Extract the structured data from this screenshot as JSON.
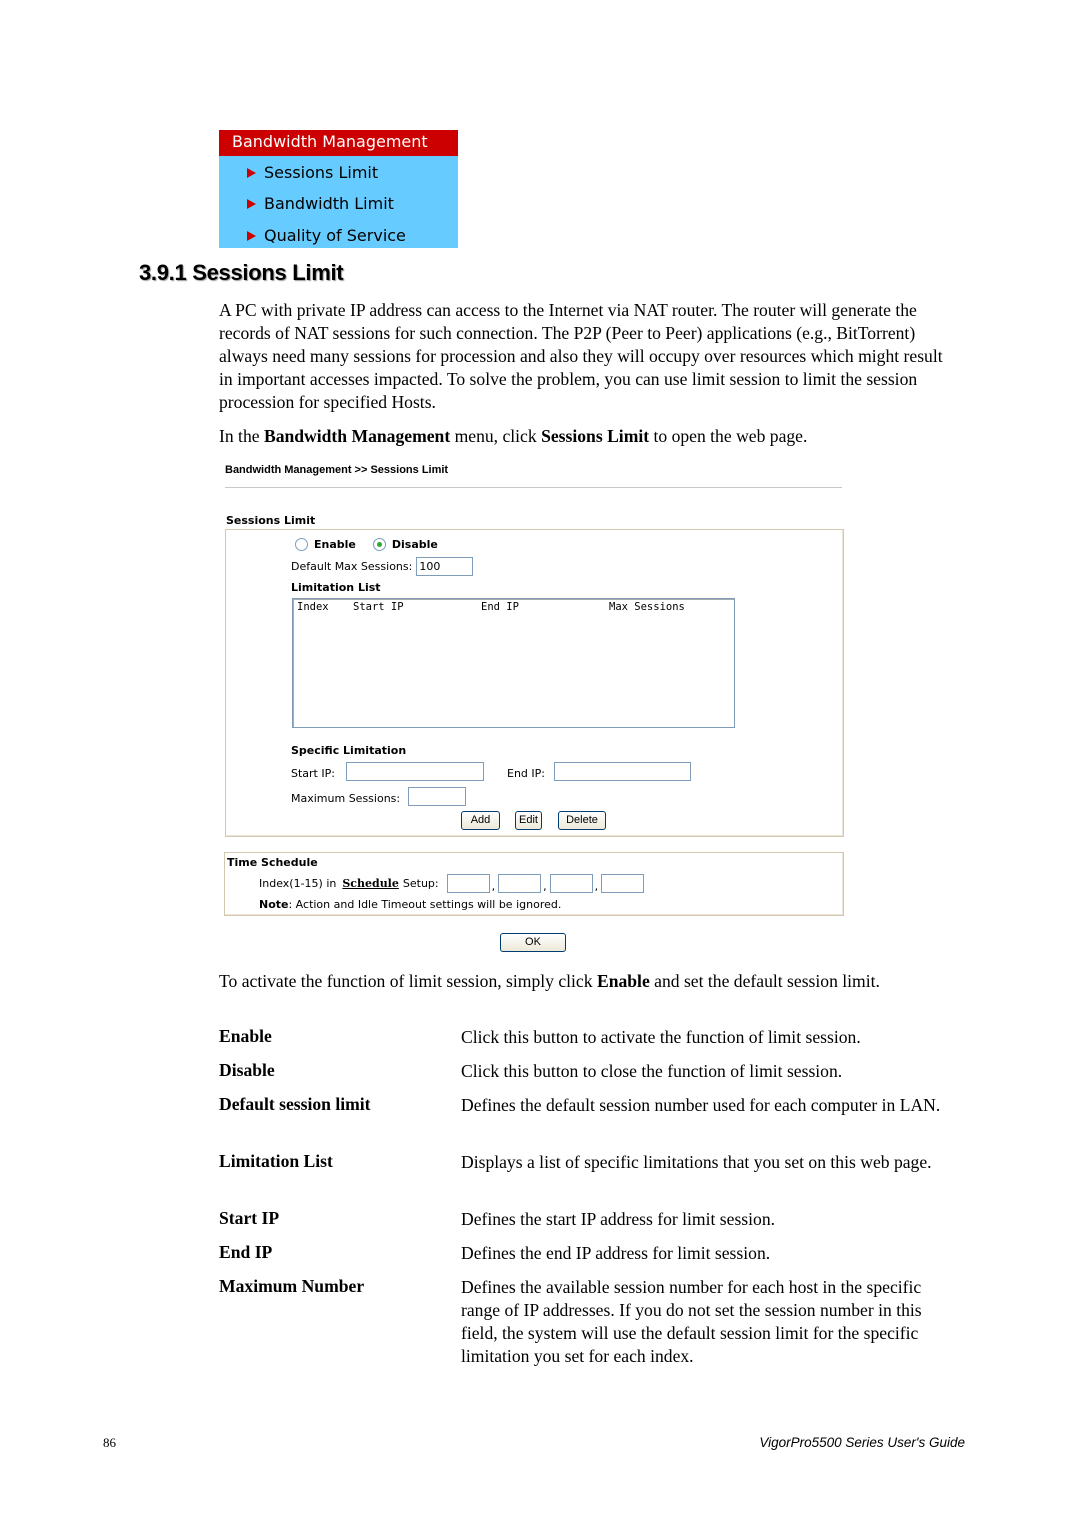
{
  "menu": {
    "title": "Bandwidth Management",
    "items": [
      {
        "label": "Sessions Limit"
      },
      {
        "label": "Bandwidth Limit"
      },
      {
        "label": "Quality of Service"
      }
    ],
    "colors": {
      "title_bg": "#cc0000",
      "body_bg": "#66ccff",
      "arrow": "#cc0000"
    }
  },
  "section": {
    "heading": "3.9.1 Sessions Limit",
    "intro": "A PC with private IP address can access to the Internet via NAT router. The router will generate the records of NAT sessions for such connection. The P2P (Peer to Peer) applications (e.g., BitTorrent) always need many sessions for procession and also they will occupy over resources which might result in important accesses impacted. To solve the problem, you can use limit session to limit the session procession for specified Hosts.",
    "instruction": {
      "prefix": "In the ",
      "menu_name": "Bandwidth Management",
      "middle": " menu, click ",
      "item_name": "Sessions Limit",
      "suffix": " to open the web page."
    },
    "activate": {
      "prefix": "To activate the function of limit session, simply click ",
      "bold": "Enable",
      "suffix": " and set the default session limit."
    }
  },
  "webui": {
    "breadcrumb": "Bandwidth Management >> Sessions Limit",
    "sessions_limit_title": "Sessions Limit",
    "radio": {
      "enable_label": "Enable",
      "disable_label": "Disable",
      "selected": "Disable"
    },
    "default_max_sessions": {
      "label": "Default Max Sessions:",
      "value": "100"
    },
    "limitation_list": {
      "title": "Limitation List",
      "columns": [
        "Index",
        "Start IP",
        "End IP",
        "Max Sessions"
      ],
      "rows": []
    },
    "specific_limitation": {
      "title": "Specific Limitation",
      "start_ip_label": "Start IP:",
      "start_ip_value": "",
      "end_ip_label": "End IP:",
      "end_ip_value": "",
      "max_sessions_label": "Maximum Sessions:",
      "max_sessions_value": ""
    },
    "buttons": {
      "add": "Add",
      "edit": "Edit",
      "delete": "Delete",
      "ok": "OK"
    },
    "time_schedule": {
      "title": "Time Schedule",
      "index_label": "Index(1-15) in",
      "schedule_link": "Schedule",
      "setup_label": "Setup:",
      "values": [
        "",
        "",
        "",
        ""
      ],
      "note_label": "Note",
      "note_text": ": Action and Idle Timeout settings will be ignored."
    }
  },
  "definitions": [
    {
      "term": "Enable",
      "desc": "Click this button to activate the function of limit session."
    },
    {
      "term": "Disable",
      "desc": "Click this button to close the function of limit session."
    },
    {
      "term": "Default session limit",
      "desc": "Defines the default session number used for each computer in LAN."
    },
    {
      "term": "Limitation List",
      "desc": "Displays a list of specific limitations that you set on this web page."
    },
    {
      "term": "Start IP",
      "desc": "Defines the start IP address for limit session."
    },
    {
      "term": "End IP",
      "desc": "Defines the end IP address for limit session."
    },
    {
      "term": "Maximum Number",
      "desc": "Defines the available session number for each host in the specific range of IP addresses. If you do not set the session number in this field, the system will use the default session limit for the specific limitation you set for each index."
    }
  ],
  "footer": {
    "page_number": "86",
    "guide_title": "VigorPro5500 Series User's Guide"
  }
}
